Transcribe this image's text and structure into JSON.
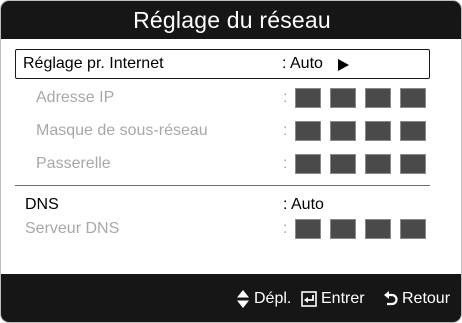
{
  "dialog": {
    "title": "Réglage du réseau"
  },
  "rows": {
    "internet_setting": {
      "label": "Réglage pr. Internet",
      "value": ": Auto"
    },
    "ip_address": {
      "label": "Adresse IP",
      "colon": ":"
    },
    "subnet_mask": {
      "label": "Masque de sous-réseau",
      "colon": ":"
    },
    "gateway": {
      "label": "Passerelle",
      "colon": ":"
    },
    "dns": {
      "label": "DNS",
      "value": ": Auto"
    },
    "dns_server": {
      "label": "Serveur DNS",
      "colon": ":"
    }
  },
  "footer": {
    "move_label": "Dépl.",
    "enter_label": "Entrer",
    "return_label": "Retour"
  },
  "icons": {
    "selected_arrow": "triangle-right-icon",
    "move": "up-down-arrows-icon",
    "enter": "enter-icon",
    "return": "return-icon"
  },
  "colors": {
    "title_bar": "#161616",
    "disabled_text": "#a8a8a8",
    "value_block": "#4a4a4a"
  }
}
